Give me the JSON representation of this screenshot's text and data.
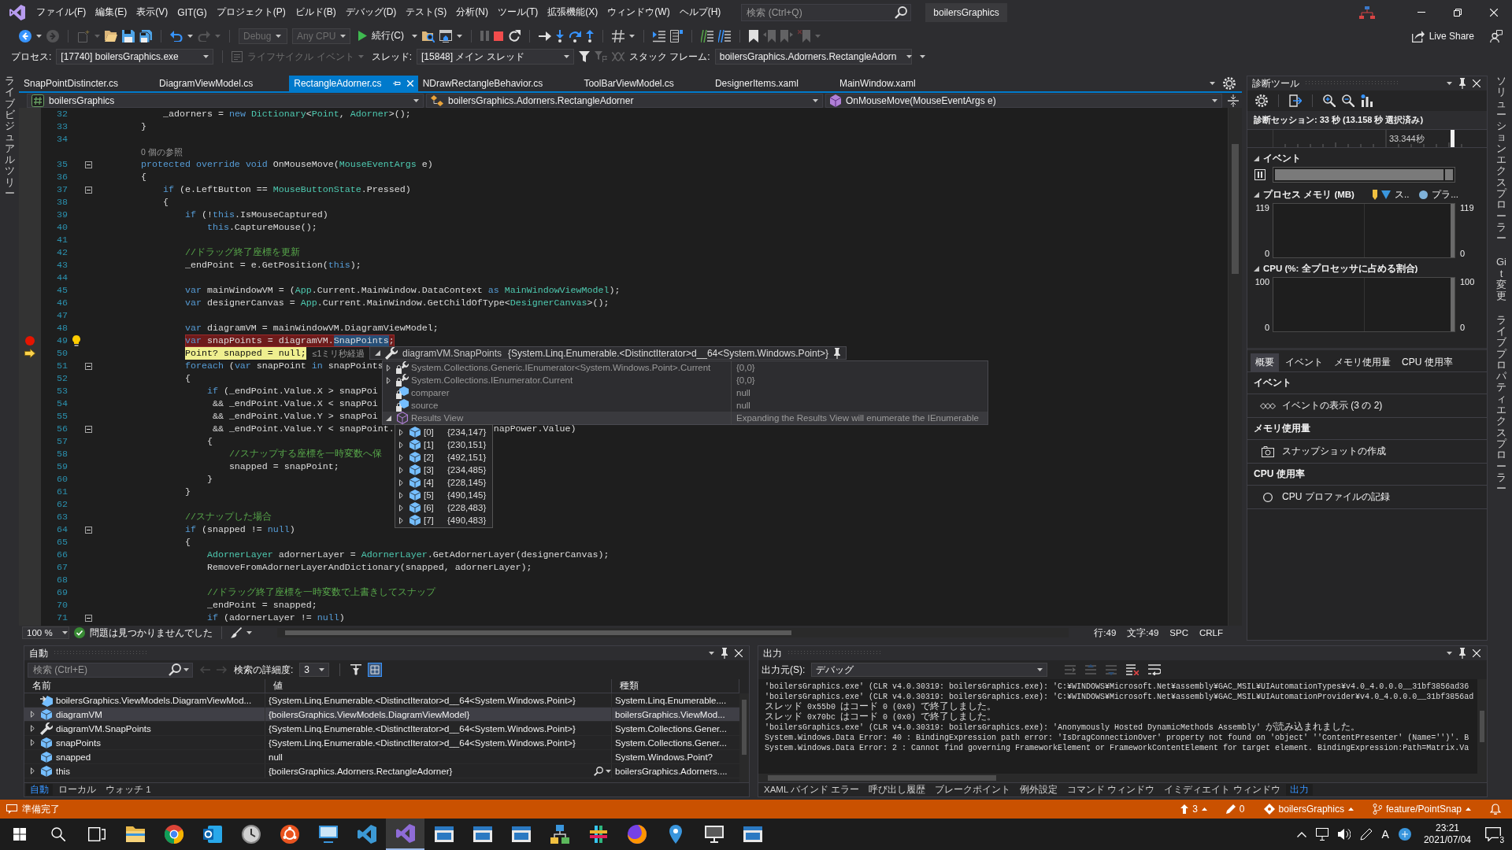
{
  "title_bar": {
    "menu": [
      "ファイル(F)",
      "編集(E)",
      "表示(V)",
      "GIT(G)",
      "プロジェクト(P)",
      "ビルド(B)",
      "デバッグ(D)",
      "テスト(S)",
      "分析(N)",
      "ツール(T)",
      "拡張機能(X)",
      "ウィンドウ(W)",
      "ヘルプ(H)"
    ],
    "search": {
      "placeholder": "検索 (Ctrl+Q)"
    },
    "solution_name": "boilersGraphics"
  },
  "toolbar": {
    "items": [
      {
        "kind": "back",
        "disabled": false
      },
      {
        "kind": "forward",
        "disabled": true
      },
      {
        "kind": "separator"
      },
      {
        "kind": "new_item",
        "disabled": true
      },
      {
        "kind": "open",
        "disabled": false
      },
      {
        "kind": "save",
        "disabled": false
      },
      {
        "kind": "save_all",
        "disabled": false
      },
      {
        "kind": "separator"
      },
      {
        "kind": "undo",
        "disabled": false
      },
      {
        "kind": "redo",
        "disabled": true
      },
      {
        "kind": "separator"
      },
      {
        "kind": "dropdown",
        "value": "Debug",
        "disabled": true
      },
      {
        "kind": "dropdown",
        "value": "Any CPU",
        "disabled": true
      },
      {
        "kind": "continue",
        "label": "続行(C)",
        "disabled": false
      },
      {
        "kind": "find_in_files",
        "disabled": false
      },
      {
        "kind": "window",
        "disabled": false
      },
      {
        "kind": "separator"
      },
      {
        "kind": "pause",
        "disabled": true
      },
      {
        "kind": "stop",
        "disabled": false
      },
      {
        "kind": "restart",
        "disabled": false
      },
      {
        "kind": "separator"
      },
      {
        "kind": "show_next",
        "disabled": false
      },
      {
        "kind": "step_into",
        "disabled": false
      },
      {
        "kind": "step_over",
        "disabled": false
      },
      {
        "kind": "step_out",
        "disabled": false
      },
      {
        "kind": "separator"
      },
      {
        "kind": "hex",
        "disabled": false
      },
      {
        "kind": "separator"
      },
      {
        "kind": "indent",
        "disabled": false
      },
      {
        "kind": "outline",
        "disabled": false
      },
      {
        "kind": "separator"
      },
      {
        "kind": "comment",
        "disabled": false
      },
      {
        "kind": "uncomment",
        "disabled": false
      },
      {
        "kind": "separator"
      },
      {
        "kind": "bookmark",
        "disabled": false
      },
      {
        "kind": "bookmark_prev",
        "disabled": true
      },
      {
        "kind": "bookmark_next",
        "disabled": true
      },
      {
        "kind": "bookmark_clear",
        "disabled": true
      }
    ],
    "live_share": "Live Share"
  },
  "debug_location": {
    "process_label": "プロセス:",
    "process": "[17740] boilersGraphics.exe",
    "lifecycle": {
      "label": "ライフサイクル イベント",
      "disabled": true
    },
    "thread_label": "スレッド:",
    "thread": "[15848] メイン スレッド",
    "filters": [
      {
        "kind": "filter",
        "disabled": false
      },
      {
        "kind": "flag_filter",
        "disabled": true
      },
      {
        "kind": "threads",
        "disabled": true
      }
    ],
    "stack_frame_label": "スタック フレーム:",
    "stack_frame": "boilersGraphics.Adorners.RectangleAdorn"
  },
  "side_tabs_left": [
    "ライブビジュアルツリー"
  ],
  "doc_tabs": [
    {
      "label": "SnapPointDistincter.cs",
      "selected": false
    },
    {
      "label": "DiagramViewModel.cs",
      "selected": false
    },
    {
      "label": "RectangleAdorner.cs",
      "selected": true
    },
    {
      "label": "NDrawRectangleBehavior.cs",
      "selected": false
    },
    {
      "label": "ToolBarViewModel.cs",
      "selected": false
    },
    {
      "label": "DesignerItems.xaml",
      "selected": false
    },
    {
      "label": "MainWindow.xaml",
      "selected": false
    }
  ],
  "navigation_bar": {
    "project": "boilersGraphics",
    "type": "boilersGraphics.Adorners.RectangleAdorner",
    "member": "OnMouseMove(MouseEventArgs e)"
  },
  "editor": {
    "lines": [
      {
        "kind": "code",
        "number": "32",
        "tokens": [
          {
            "kind": "plain",
            "text": "            _adorners = "
          },
          {
            "kind": "keyword",
            "text": "new "
          },
          {
            "kind": "type",
            "text": "Dictionary"
          },
          {
            "kind": "plain",
            "text": "<"
          },
          {
            "kind": "type",
            "text": "Point"
          },
          {
            "kind": "plain",
            "text": ", "
          },
          {
            "kind": "type",
            "text": "Adorner"
          },
          {
            "kind": "plain",
            "text": ">();"
          }
        ]
      },
      {
        "kind": "code",
        "number": "33",
        "tokens": [
          {
            "kind": "plain",
            "text": "        }"
          }
        ]
      },
      {
        "kind": "code",
        "number": "34"
      },
      {
        "kind": "codelens",
        "text": "0 個の参照"
      },
      {
        "kind": "code",
        "number": "35",
        "markers": [
          {
            "kind": "fold"
          }
        ],
        "tokens": [
          {
            "kind": "keyword",
            "text": "        protected "
          },
          {
            "kind": "keyword",
            "text": "override "
          },
          {
            "kind": "keyword",
            "text": "void"
          },
          {
            "kind": "plain",
            "text": " OnMouseMove("
          },
          {
            "kind": "type",
            "text": "MouseEventArgs"
          },
          {
            "kind": "plain",
            "text": " e)"
          }
        ]
      },
      {
        "kind": "code",
        "number": "36",
        "tokens": [
          {
            "kind": "plain",
            "text": "        {"
          }
        ]
      },
      {
        "kind": "code",
        "number": "37",
        "markers": [
          {
            "kind": "fold"
          }
        ],
        "tokens": [
          {
            "kind": "keyword",
            "text": "            if"
          },
          {
            "kind": "plain",
            "text": " (e.LeftButton == "
          },
          {
            "kind": "type",
            "text": "MouseButtonState"
          },
          {
            "kind": "plain",
            "text": ".Pressed)"
          }
        ]
      },
      {
        "kind": "code",
        "number": "38",
        "tokens": [
          {
            "kind": "plain",
            "text": "            {"
          }
        ]
      },
      {
        "kind": "code",
        "number": "39",
        "tokens": [
          {
            "kind": "keyword",
            "text": "                if"
          },
          {
            "kind": "plain",
            "text": " (!"
          },
          {
            "kind": "keyword",
            "text": "this"
          },
          {
            "kind": "plain",
            "text": ".IsMouseCaptured)"
          }
        ]
      },
      {
        "kind": "code",
        "number": "40",
        "tokens": [
          {
            "kind": "keyword",
            "text": "                    this"
          },
          {
            "kind": "plain",
            "text": ".CaptureMouse();"
          }
        ]
      },
      {
        "kind": "code",
        "number": "41"
      },
      {
        "kind": "code",
        "number": "42",
        "tokens": [
          {
            "kind": "comment",
            "text": "                //ドラッグ終了座標を更新"
          }
        ]
      },
      {
        "kind": "code",
        "number": "43",
        "tokens": [
          {
            "kind": "plain",
            "text": "                _endPoint = e.GetPosition("
          },
          {
            "kind": "keyword",
            "text": "this"
          },
          {
            "kind": "plain",
            "text": ");"
          }
        ]
      },
      {
        "kind": "code",
        "number": "44"
      },
      {
        "kind": "code",
        "number": "45",
        "tokens": [
          {
            "kind": "keyword",
            "text": "                var"
          },
          {
            "kind": "plain",
            "text": " mainWindowVM = ("
          },
          {
            "kind": "type",
            "text": "App"
          },
          {
            "kind": "plain",
            "text": ".Current.MainWindow.DataContext "
          },
          {
            "kind": "keyword",
            "text": "as "
          },
          {
            "kind": "type",
            "text": "MainWindowViewModel"
          },
          {
            "kind": "plain",
            "text": ");"
          }
        ]
      },
      {
        "kind": "code",
        "number": "46",
        "tokens": [
          {
            "kind": "keyword",
            "text": "                var"
          },
          {
            "kind": "plain",
            "text": " designerCanvas = "
          },
          {
            "kind": "type",
            "text": "App"
          },
          {
            "kind": "plain",
            "text": ".Current.MainWindow.GetChildOfType<"
          },
          {
            "kind": "type",
            "text": "DesignerCanvas"
          },
          {
            "kind": "plain",
            "text": ">();"
          }
        ]
      },
      {
        "kind": "code",
        "number": "47"
      },
      {
        "kind": "code",
        "number": "48",
        "tokens": [
          {
            "kind": "keyword",
            "text": "                var"
          },
          {
            "kind": "plain",
            "text": " diagramVM = mainWindowVM.DiagramViewModel;"
          }
        ]
      },
      {
        "kind": "code",
        "number": "49",
        "markers": [
          {
            "kind": "breakpoint"
          },
          {
            "kind": "lightbulb"
          }
        ],
        "tokens": [
          {
            "kind": "keyword",
            "text": "                var"
          },
          {
            "kind": "plain",
            "text": " snapPoints = diagramVM."
          },
          {
            "kind": "selection",
            "text": "SnapPoints"
          },
          {
            "kind": "plain",
            "text": ";"
          }
        ]
      },
      {
        "kind": "code",
        "number": "50",
        "markers": [
          {
            "kind": "current"
          }
        ],
        "hint": "≤1ミリ秒経過",
        "tokens": [
          {
            "kind": "type",
            "text": "                Point"
          },
          {
            "kind": "plain",
            "text": "? snapped = "
          },
          {
            "kind": "keyword",
            "text": "null"
          },
          {
            "kind": "plain",
            "text": ";"
          }
        ]
      },
      {
        "kind": "code",
        "number": "51",
        "markers": [
          {
            "kind": "fold"
          }
        ],
        "tokens": [
          {
            "kind": "keyword",
            "text": "                foreach"
          },
          {
            "kind": "plain",
            "text": " ("
          },
          {
            "kind": "keyword",
            "text": "var"
          },
          {
            "kind": "plain",
            "text": " snapPoint "
          },
          {
            "kind": "keyword",
            "text": "in"
          },
          {
            "kind": "plain",
            "text": " snapPoints"
          }
        ]
      },
      {
        "kind": "code",
        "number": "52",
        "tokens": [
          {
            "kind": "plain",
            "text": "                {"
          }
        ]
      },
      {
        "kind": "code",
        "number": "53",
        "tokens": [
          {
            "kind": "keyword",
            "text": "                    if"
          },
          {
            "kind": "plain",
            "text": " (_endPoint.Value.X > snapPoi"
          }
        ]
      },
      {
        "kind": "code",
        "number": "54",
        "tokens": [
          {
            "kind": "plain",
            "text": "                     && _endPoint.Value.X < snapPoi"
          }
        ]
      },
      {
        "kind": "code",
        "number": "55",
        "tokens": [
          {
            "kind": "plain",
            "text": "                     && _endPoint.Value.Y > snapPoi"
          }
        ]
      },
      {
        "kind": "code",
        "number": "56",
        "markers": [
          {
            "kind": "fold"
          }
        ],
        "tokens": [
          {
            "kind": "plain",
            "text": "                     && _endPoint.Value.Y < snapPoint."
          }
        ],
        "tail": [
          {
            "kind": "plain",
            "text": "napPower.Value)"
          }
        ]
      },
      {
        "kind": "code",
        "number": "57",
        "tokens": [
          {
            "kind": "plain",
            "text": "                    {"
          }
        ]
      },
      {
        "kind": "code",
        "number": "58",
        "tokens": [
          {
            "kind": "comment",
            "text": "                        //スナップする座標を一時変数へ保"
          }
        ]
      },
      {
        "kind": "code",
        "number": "59",
        "tokens": [
          {
            "kind": "plain",
            "text": "                        snapped = snapPoint;"
          }
        ]
      },
      {
        "kind": "code",
        "number": "60",
        "tokens": [
          {
            "kind": "plain",
            "text": "                    }"
          }
        ]
      },
      {
        "kind": "code",
        "number": "61",
        "tokens": [
          {
            "kind": "plain",
            "text": "                }"
          }
        ]
      },
      {
        "kind": "code",
        "number": "62"
      },
      {
        "kind": "code",
        "number": "63",
        "tokens": [
          {
            "kind": "comment",
            "text": "                //スナップした場合"
          }
        ]
      },
      {
        "kind": "code",
        "number": "64",
        "markers": [
          {
            "kind": "fold"
          }
        ],
        "tokens": [
          {
            "kind": "keyword",
            "text": "                if"
          },
          {
            "kind": "plain",
            "text": " (snapped != "
          },
          {
            "kind": "keyword",
            "text": "null"
          },
          {
            "kind": "plain",
            "text": ")"
          }
        ]
      },
      {
        "kind": "code",
        "number": "65",
        "tokens": [
          {
            "kind": "plain",
            "text": "                {"
          }
        ]
      },
      {
        "kind": "code",
        "number": "66",
        "tokens": [
          {
            "kind": "type",
            "text": "                    AdornerLayer"
          },
          {
            "kind": "plain",
            "text": " adornerLayer = "
          },
          {
            "kind": "type",
            "text": "AdornerLayer"
          },
          {
            "kind": "plain",
            "text": ".GetAdornerLayer(designerCanvas);"
          }
        ]
      },
      {
        "kind": "code",
        "number": "67",
        "tokens": [
          {
            "kind": "plain",
            "text": "                    RemoveFromAdornerLayerAndDictionary(snapped, adornerLayer);"
          }
        ]
      },
      {
        "kind": "code",
        "number": "68"
      },
      {
        "kind": "code",
        "number": "69",
        "tokens": [
          {
            "kind": "comment",
            "text": "                    //ドラッグ終了座標を一時変数で上書きしてスナップ"
          }
        ]
      },
      {
        "kind": "code",
        "number": "70",
        "tokens": [
          {
            "kind": "plain",
            "text": "                    _endPoint = snapped;"
          }
        ]
      },
      {
        "kind": "code",
        "number": "71",
        "markers": [
          {
            "kind": "fold"
          }
        ],
        "tokens": [
          {
            "kind": "keyword",
            "text": "                    if"
          },
          {
            "kind": "plain",
            "text": " (adornerLayer != "
          },
          {
            "kind": "keyword",
            "text": "null"
          },
          {
            "kind": "plain",
            "text": ")"
          }
        ]
      }
    ],
    "datatip": {
      "expression": "diagramVM.SnapPoints",
      "value": "{System.Linq.Enumerable.<DistinctIterator>d__64<System.Windows.Point>}",
      "expanded": true,
      "members": [
        {
          "kind": "property",
          "expanded": false,
          "name": "System.Collections.Generic.IEnumerator<System.Windows.Point>.Current",
          "value": "{0,0}"
        },
        {
          "kind": "property",
          "expanded": false,
          "name": "System.Collections.IEnumerator.Current",
          "value": "{0,0}"
        },
        {
          "kind": "field",
          "expanded": false,
          "name": "comparer",
          "value": "null"
        },
        {
          "kind": "field",
          "expanded": false,
          "name": "source",
          "value": "null"
        },
        {
          "kind": "results",
          "expanded": true,
          "name": "Results View",
          "value": "Expanding the Results View will enumerate the IEnumerable"
        }
      ],
      "results": [
        {
          "index": "[0]",
          "value": "{234,147}",
          "expanded": false
        },
        {
          "index": "[1]",
          "value": "{230,151}",
          "expanded": false
        },
        {
          "index": "[2]",
          "value": "{492,151}",
          "expanded": false
        },
        {
          "index": "[3]",
          "value": "{234,485}",
          "expanded": false
        },
        {
          "index": "[4]",
          "value": "{228,145}",
          "expanded": false
        },
        {
          "index": "[5]",
          "value": "{490,145}",
          "expanded": false
        },
        {
          "index": "[6]",
          "value": "{228,483}",
          "expanded": false
        },
        {
          "index": "[7]",
          "value": "{490,483}",
          "expanded": false
        }
      ]
    },
    "status": {
      "zoom": "100 %",
      "issues": "問題は見つかりませんでした",
      "line": "行:49",
      "column": "文字:49",
      "whitespace": "SPC",
      "line_endings": "CRLF"
    }
  },
  "diagnostics": {
    "title": "診断ツール",
    "session": "診断セッション: 33 秒 (13.158 秒 選択済み)",
    "timeline_label": "33.344秒",
    "sections": [
      {
        "kind": "events",
        "title": "イベント",
        "expanded": true
      },
      {
        "kind": "chart",
        "title": "プロセス メモリ (MB)",
        "expanded": true,
        "legend": [
          {
            "kind": "marker",
            "color": "#f0c040"
          },
          {
            "kind": "triangle",
            "color": "#3a96dd",
            "label": "ス.."
          },
          {
            "kind": "circle",
            "color": "#7fb2d9",
            "label": "プラ..."
          }
        ],
        "left_axis": {
          "max": "119",
          "min": "0"
        },
        "right_axis": {
          "max": "119",
          "min": "0"
        }
      },
      {
        "kind": "chart",
        "title": "CPU (%: 全プロセッサに占める割合)",
        "expanded": true,
        "left_axis": {
          "max": "100",
          "min": "0"
        },
        "right_axis": {
          "max": "100",
          "min": "0"
        }
      }
    ],
    "tabs": [
      {
        "label": "概要",
        "selected": true
      },
      {
        "label": "イベント",
        "selected": false
      },
      {
        "label": "メモリ使用量",
        "selected": false
      },
      {
        "label": "CPU 使用率",
        "selected": false
      }
    ],
    "summary": [
      {
        "heading": "イベント",
        "kind": "events",
        "action": "イベントの表示 (3 の 2)"
      },
      {
        "heading": "メモリ使用量",
        "kind": "snapshot",
        "action": "スナップショットの作成"
      },
      {
        "heading": "CPU 使用率",
        "kind": "record",
        "action": "CPU プロファイルの記録"
      }
    ]
  },
  "side_tabs_right": [
    "ソリューションエクスプローラー",
    "Git 変更",
    "ライブプロパティエクスプローラー"
  ],
  "autos": {
    "title": "自動",
    "search_placeholder": "検索 (Ctrl+E)",
    "history": [
      {
        "kind": "back",
        "disabled": true
      },
      {
        "kind": "forward",
        "disabled": true
      }
    ],
    "depth_label": "検索の詳細度:",
    "depth": "3",
    "view_buttons": [
      {
        "kind": "filter",
        "on": false
      },
      {
        "kind": "grid",
        "on": true
      }
    ],
    "columns": [
      "名前",
      "値",
      "種類"
    ],
    "rows": [
      {
        "kind": "return",
        "expanded": false,
        "name": "boilersGraphics.ViewModels.DiagramViewMod...",
        "value": "{System.Linq.Enumerable.<DistinctIterator>d__64<System.Windows.Point>}",
        "type": "System.Linq.Enumerable....",
        "selected": false,
        "visualizer": false
      },
      {
        "kind": "object",
        "expanded": false,
        "name": "diagramVM",
        "value": "{boilersGraphics.ViewModels.DiagramViewModel}",
        "type": "boilersGraphics.ViewMod...",
        "selected": true,
        "visualizer": false
      },
      {
        "kind": "property",
        "expanded": false,
        "name": "diagramVM.SnapPoints",
        "value": "{System.Linq.Enumerable.<DistinctIterator>d__64<System.Windows.Point>}",
        "type": "System.Collections.Gener...",
        "selected": false,
        "visualizer": false
      },
      {
        "kind": "object",
        "expanded": false,
        "name": "snapPoints",
        "value": "{System.Linq.Enumerable.<DistinctIterator>d__64<System.Windows.Point>}",
        "type": "System.Collections.Gener...",
        "selected": false,
        "visualizer": false
      },
      {
        "kind": "value",
        "expanded": false,
        "name": "snapped",
        "value": "null",
        "type": "System.Windows.Point?",
        "selected": false,
        "visualizer": false
      },
      {
        "kind": "object",
        "expanded": false,
        "name": "this",
        "value": "{boilersGraphics.Adorners.RectangleAdorner}",
        "type": "boilersGraphics.Adorners....",
        "selected": false,
        "visualizer": true
      }
    ],
    "tabs": [
      {
        "label": "自動",
        "selected": true
      },
      {
        "label": "ローカル",
        "selected": false
      },
      {
        "label": "ウォッチ 1",
        "selected": false
      }
    ]
  },
  "output": {
    "title": "出力",
    "source_label": "出力元(S):",
    "source": "デバッグ",
    "tools": [
      {
        "kind": "goto",
        "disabled": true
      },
      {
        "kind": "prev",
        "disabled": true
      },
      {
        "kind": "next",
        "disabled": true
      },
      {
        "kind": "clear",
        "disabled": false
      },
      {
        "kind": "wrap",
        "disabled": false
      }
    ],
    "lines": [
      "'boilersGraphics.exe' (CLR v4.0.30319: boilersGraphics.exe): 'C:¥WINDOWS¥Microsoft.Net¥assembly¥GAC_MSIL¥UIAutomationTypes¥v4.0_4.0.0.0__31bf3856ad36",
      "'boilersGraphics.exe' (CLR v4.0.30319: boilersGraphics.exe): 'C:¥WINDOWS¥Microsoft.Net¥assembly¥GAC_MSIL¥UIAutomationProvider¥v4.0_4.0.0.0__31bf3856ad",
      "スレッド 0x55b0 はコード 0 (0x0) で終了しました。",
      "スレッド 0x70bc はコード 0 (0x0) で終了しました。",
      "'boilersGraphics.exe' (CLR v4.0.30319: boilersGraphics.exe): 'Anonymously Hosted DynamicMethods Assembly' が読み込まれました。",
      "System.Windows.Data Error: 40 : BindingExpression path error: 'IsDragConnectionOver' property not found on 'object' ''ContentPresenter' (Name='')'. B",
      "System.Windows.Data Error: 2 : Cannot find governing FrameworkElement or FrameworkContentElement for target element. BindingExpression:Path=Matrix.Va"
    ],
    "tabs": [
      {
        "label": "XAML バインド エラー",
        "selected": false
      },
      {
        "label": "呼び出し履歴",
        "selected": false
      },
      {
        "label": "ブレークポイント",
        "selected": false
      },
      {
        "label": "例外設定",
        "selected": false
      },
      {
        "label": "コマンド ウィンドウ",
        "selected": false
      },
      {
        "label": "イミディエイト ウィンドウ",
        "selected": false
      },
      {
        "label": "出力",
        "selected": true
      }
    ]
  },
  "status_bar": {
    "message": "準備完了",
    "push_count": "3",
    "pending_changes": "0",
    "repository": "boilersGraphics",
    "branch": "feature/PointSnap"
  },
  "taskbar": {
    "apps": [
      {
        "kind": "start",
        "active": false
      },
      {
        "kind": "search",
        "active": false
      },
      {
        "kind": "task_view",
        "active": false
      },
      {
        "kind": "files",
        "active": false
      },
      {
        "kind": "browser",
        "active": false
      },
      {
        "kind": "mail",
        "active": false
      },
      {
        "kind": "clock",
        "active": false
      },
      {
        "kind": "terminal",
        "active": false
      },
      {
        "kind": "remote",
        "active": false
      },
      {
        "kind": "code_editor",
        "active": false
      },
      {
        "kind": "ide",
        "active": true
      },
      {
        "kind": "window",
        "active": false
      },
      {
        "kind": "window",
        "active": false
      },
      {
        "kind": "window",
        "active": false
      },
      {
        "kind": "network",
        "active": false
      },
      {
        "kind": "chat",
        "active": false
      },
      {
        "kind": "browser_alt",
        "active": false
      },
      {
        "kind": "maps",
        "active": false
      },
      {
        "kind": "monitor",
        "active": false
      },
      {
        "kind": "window",
        "active": false
      }
    ],
    "ime_mode": "A",
    "time": "23:21",
    "date": "2021/07/04",
    "notifications": "3"
  }
}
